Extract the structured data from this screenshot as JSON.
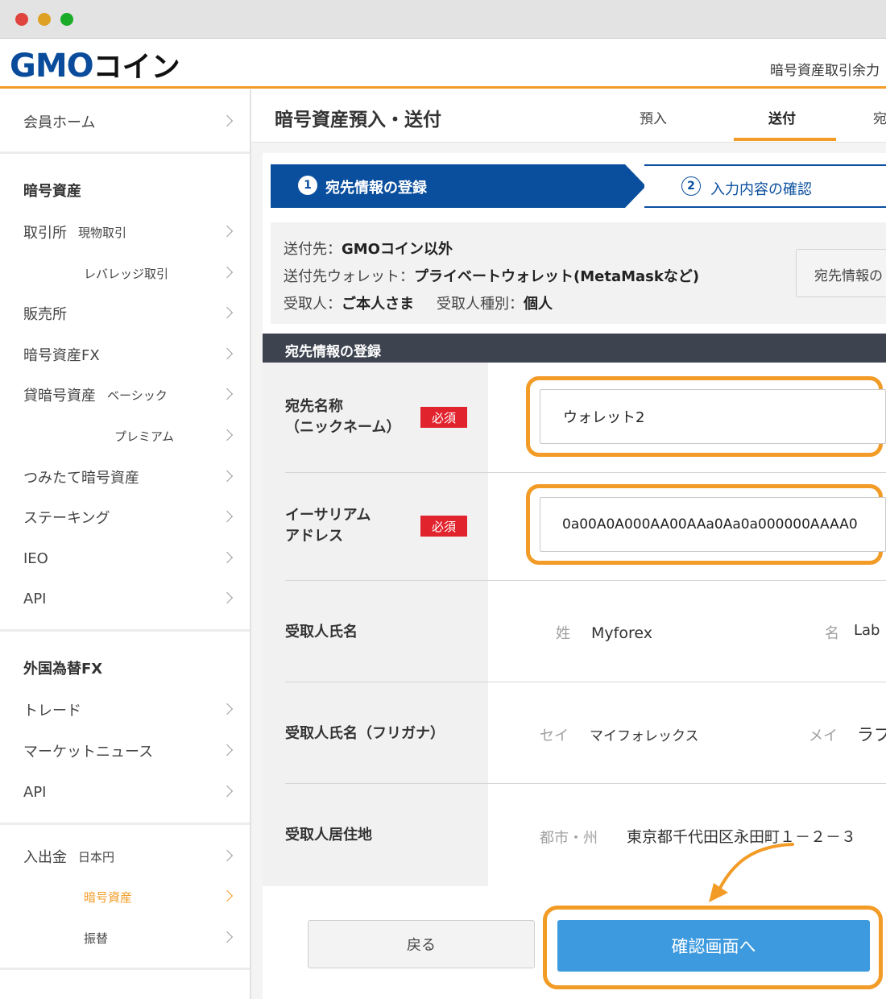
{
  "header": {
    "logo_latin": "GMO",
    "logo_kana": "コイン",
    "right_link": "暗号資産取引余力"
  },
  "sidebar": {
    "member_home": "会員ホーム",
    "crypto_heading": "暗号資産",
    "exchange": "取引所",
    "exchange_spot": "現物取引",
    "exchange_leverage": "レバレッジ取引",
    "sales": "販売所",
    "crypto_fx": "暗号資産FX",
    "lending": "貸暗号資産",
    "lending_basic": "ベーシック",
    "lending_premium": "プレミアム",
    "tsumitate": "つみたて暗号資産",
    "staking": "ステーキング",
    "ieo": "IEO",
    "api1": "API",
    "fx_heading": "外国為替FX",
    "trade": "トレード",
    "market_news": "マーケットニュース",
    "api2": "API",
    "deposit": "入出金",
    "deposit_jpy": "日本円",
    "deposit_crypto": "暗号資産",
    "transfer": "振替"
  },
  "main": {
    "page_title": "暗号資産預入・送付",
    "tabs": [
      "預入",
      "送付",
      "宛"
    ],
    "steps": [
      {
        "num": "1",
        "label": "宛先情報の登録"
      },
      {
        "num": "2",
        "label": "入力内容の確認"
      }
    ],
    "info": {
      "dest_label": "送付先：",
      "dest_value": "GMOコイン以外",
      "wallet_label": "送付先ウォレット：",
      "wallet_value": "プライベートウォレット(MetaMaskなど)",
      "recipient_label": "受取人：",
      "recipient_value": "ご本人さま",
      "recipient_type_label": "受取人種別：",
      "recipient_type_value": "個人",
      "edit_button": "宛先情報の"
    },
    "form": {
      "header": "宛先情報の登録",
      "required_badge": "必須",
      "name_label_1": "宛先名称",
      "name_label_2": "（ニックネーム）",
      "name_value": "ウォレット2",
      "address_label_1": "イーサリアム",
      "address_label_2": "アドレス",
      "address_value": "0a00A0A000AA00AAa0Aa0a000000AAAA0",
      "recipient_name_label": "受取人氏名",
      "last_name_label": "姓",
      "last_name_value": "Myforex",
      "first_name_label": "名",
      "first_name_value": "Lab",
      "kana_label": "受取人氏名（フリガナ）",
      "sei_label": "セイ",
      "sei_value": "マイフォレックス",
      "mei_label": "メイ",
      "mei_value": "ラブ",
      "address_res_label": "受取人居住地",
      "city_label": "都市・州",
      "city_value": "東京都千代田区永田町１－２－３"
    },
    "buttons": {
      "back": "戻る",
      "confirm": "確認画面へ"
    }
  }
}
